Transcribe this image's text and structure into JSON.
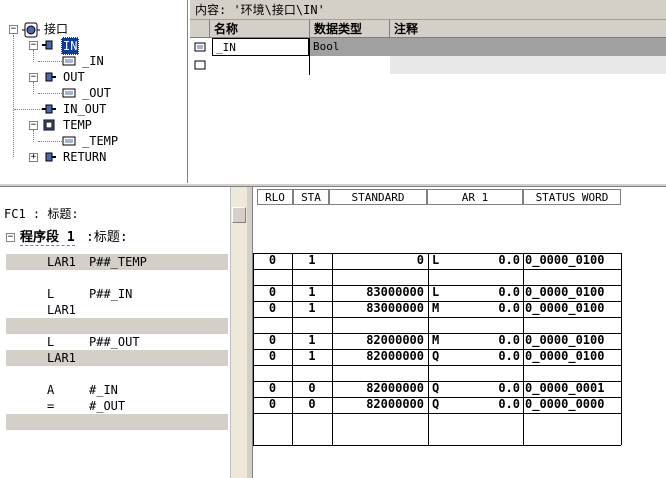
{
  "tree": {
    "root": "接口",
    "items": [
      {
        "label": "IN",
        "selected": true
      },
      {
        "label": "_IN"
      },
      {
        "label": "OUT"
      },
      {
        "label": "_OUT"
      },
      {
        "label": "IN_OUT"
      },
      {
        "label": "TEMP"
      },
      {
        "label": "_TEMP"
      },
      {
        "label": "RETURN"
      }
    ]
  },
  "content_path": "内容:  '环境\\接口\\IN'",
  "interface_table": {
    "headers": [
      "名称",
      "数据类型",
      "注释"
    ],
    "rows": [
      {
        "name": "_IN",
        "type": "Bool",
        "comment": ""
      },
      {
        "name": "",
        "type": "",
        "comment": ""
      }
    ]
  },
  "code": {
    "block_title": "FC1 : 标题:",
    "network_label": "程序段 1",
    "network_title": ":标题:",
    "lines": [
      {
        "op": "LAR1",
        "arg": "P##_TEMP"
      },
      {
        "op": "",
        "arg": ""
      },
      {
        "op": "L",
        "arg": "P##_IN"
      },
      {
        "op": "LAR1",
        "arg": ""
      },
      {
        "op": "",
        "arg": ""
      },
      {
        "op": "L",
        "arg": "P##_OUT"
      },
      {
        "op": "LAR1",
        "arg": ""
      },
      {
        "op": "",
        "arg": ""
      },
      {
        "op": "A",
        "arg": "#_IN"
      },
      {
        "op": "=",
        "arg": "#_OUT"
      },
      {
        "op": "",
        "arg": ""
      }
    ]
  },
  "status": {
    "headers": [
      "RLO",
      "STA",
      "STANDARD",
      "AR 1",
      "STATUS WORD"
    ],
    "rows": [
      {
        "rlo": "0",
        "sta": "1",
        "std": "0",
        "ar_area": "L",
        "ar_val": "0.0",
        "sw": "0_0000_0100"
      },
      {
        "rlo": "",
        "sta": "",
        "std": "",
        "ar_area": "",
        "ar_val": "",
        "sw": ""
      },
      {
        "rlo": "0",
        "sta": "1",
        "std": "83000000",
        "ar_area": "L",
        "ar_val": "0.0",
        "sw": "0_0000_0100"
      },
      {
        "rlo": "0",
        "sta": "1",
        "std": "83000000",
        "ar_area": "M",
        "ar_val": "0.0",
        "sw": "0_0000_0100"
      },
      {
        "rlo": "",
        "sta": "",
        "std": "",
        "ar_area": "",
        "ar_val": "",
        "sw": ""
      },
      {
        "rlo": "0",
        "sta": "1",
        "std": "82000000",
        "ar_area": "M",
        "ar_val": "0.0",
        "sw": "0_0000_0100"
      },
      {
        "rlo": "0",
        "sta": "1",
        "std": "82000000",
        "ar_area": "Q",
        "ar_val": "0.0",
        "sw": "0_0000_0100"
      },
      {
        "rlo": "",
        "sta": "",
        "std": "",
        "ar_area": "",
        "ar_val": "",
        "sw": ""
      },
      {
        "rlo": "0",
        "sta": "0",
        "std": "82000000",
        "ar_area": "Q",
        "ar_val": "0.0",
        "sw": "0_0000_0001"
      },
      {
        "rlo": "0",
        "sta": "0",
        "std": "82000000",
        "ar_area": "Q",
        "ar_val": "0.0",
        "sw": "0_0000_0000"
      }
    ]
  }
}
